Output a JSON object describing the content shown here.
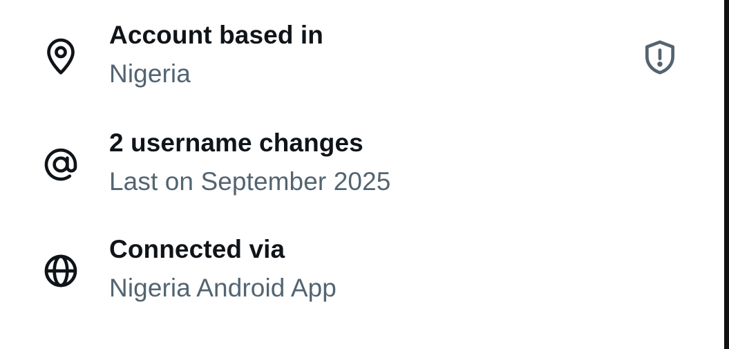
{
  "rows": [
    {
      "icon": "location-pin-icon",
      "title": "Account based in",
      "subtitle": "Nigeria"
    },
    {
      "icon": "at-sign-icon",
      "title": "2 username changes",
      "subtitle": "Last on September 2025"
    },
    {
      "icon": "globe-icon",
      "title": "Connected via",
      "subtitle": "Nigeria Android App"
    }
  ],
  "colors": {
    "title": "#0f1419",
    "subtitle": "#536471",
    "shield": "#536471",
    "background": "#ffffff"
  },
  "shield_icon": "shield-alert-icon"
}
